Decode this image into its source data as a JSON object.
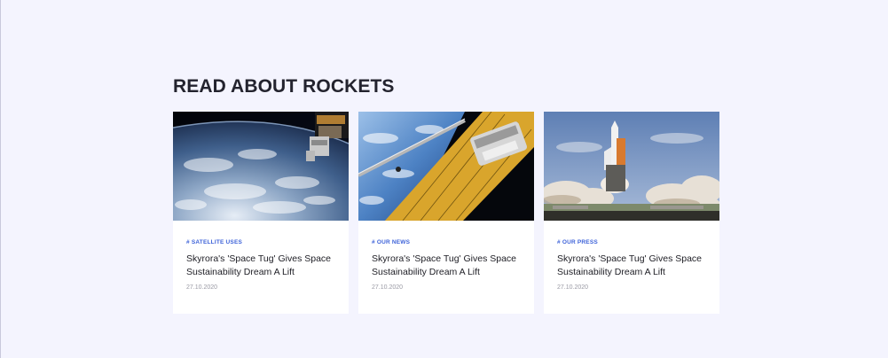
{
  "section": {
    "title": "READ ABOUT ROCKETS"
  },
  "cards": [
    {
      "image": "earth-orbit-satellite-image",
      "tag": "# SATELLITE USES",
      "title": "Skyrora's 'Space Tug' Gives Space Sustainability Dream A Lift",
      "date": "27.10.2020"
    },
    {
      "image": "space-station-solar-panel-image",
      "tag": "# OUR NEWS",
      "title": "Skyrora's 'Space Tug' Gives Space Sustainability Dream A Lift",
      "date": "27.10.2020"
    },
    {
      "image": "shuttle-launch-image",
      "tag": "# OUR PRESS",
      "title": "Skyrora's 'Space Tug' Gives Space Sustainability Dream A Lift",
      "date": "27.10.2020"
    }
  ],
  "colors": {
    "background": "#f4f4fe",
    "tag": "#3e63d9",
    "title": "#23232e"
  }
}
